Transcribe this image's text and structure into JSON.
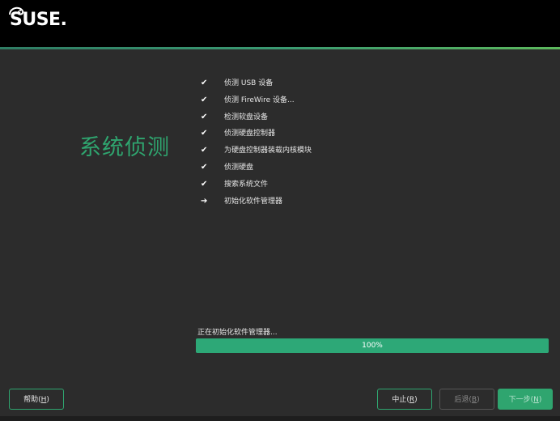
{
  "brand": {
    "logo_text": "SUSE.",
    "accent_color": "#2fa56f",
    "topbar_color": "#000000"
  },
  "page": {
    "title": "系统侦测"
  },
  "steps": [
    {
      "mark": "✔",
      "label": "侦测 USB 设备"
    },
    {
      "mark": "✔",
      "label": "侦测 FireWire 设备..."
    },
    {
      "mark": "✔",
      "label": "检测软盘设备"
    },
    {
      "mark": "✔",
      "label": "侦测硬盘控制器"
    },
    {
      "mark": "✔",
      "label": "为硬盘控制器装载内核模块"
    },
    {
      "mark": "✔",
      "label": "侦测硬盘"
    },
    {
      "mark": "✔",
      "label": "搜索系统文件"
    },
    {
      "mark": "➔",
      "label": "初始化软件管理器"
    }
  ],
  "status": {
    "text": "正在初始化软件管理器..."
  },
  "progress": {
    "percent": 100,
    "label": "100%"
  },
  "buttons": {
    "help": {
      "label": "帮助(",
      "key": "H",
      "suffix": ")"
    },
    "abort": {
      "label": "中止(",
      "key": "R",
      "suffix": ")"
    },
    "back": {
      "label": "后退(",
      "key": "B",
      "suffix": ")"
    },
    "next": {
      "label": "下一步(",
      "key": "N",
      "suffix": ")"
    }
  }
}
